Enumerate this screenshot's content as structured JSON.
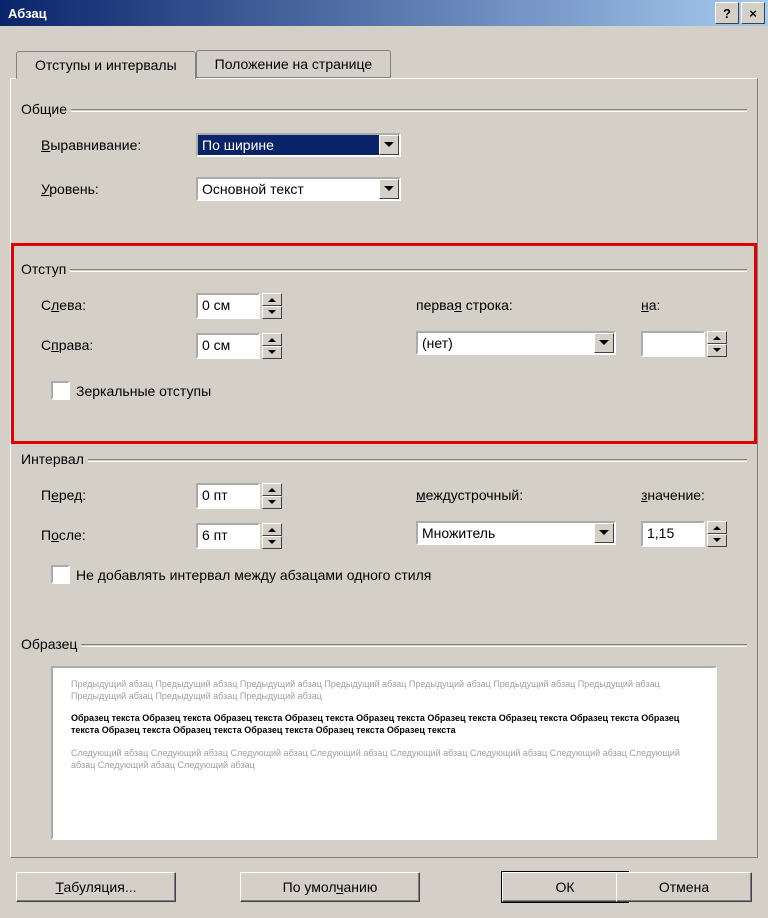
{
  "title": "Абзац",
  "tabs": {
    "active": "Отступы и интервалы",
    "other": "Положение на странице"
  },
  "groups": {
    "general": {
      "legend": "Общие",
      "alignment_label": "Выравнивание:",
      "alignment_value": "По ширине",
      "level_label": "Уровень:",
      "level_value": "Основной текст"
    },
    "indent": {
      "legend": "Отступ",
      "left_label": "Слева:",
      "left_value": "0 см",
      "right_label": "Справа:",
      "right_value": "0 см",
      "firstline_label": "первая строка:",
      "firstline_value": "(нет)",
      "by_label": "на:",
      "by_value": "",
      "mirror_label": "Зеркальные отступы"
    },
    "spacing": {
      "legend": "Интервал",
      "before_label": "Перед:",
      "before_value": "0 пт",
      "after_label": "После:",
      "after_value": "6 пт",
      "line_label": "междустрочный:",
      "line_value": "Множитель",
      "at_label": "значение:",
      "at_value": "1,15",
      "noadd_label": "Не добавлять интервал между абзацами одного стиля"
    },
    "preview": {
      "legend": "Образец",
      "prev_para": "Предыдущий абзац Предыдущий абзац Предыдущий абзац Предыдущий абзац Предыдущий абзац Предыдущий абзац Предыдущий абзац Предыдущий абзац Предыдущий абзац Предыдущий абзац",
      "sample": "Образец текста Образец текста Образец текста Образец текста Образец текста Образец текста Образец текста Образец текста Образец текста Образец текста Образец текста Образец текста Образец текста Образец текста",
      "next_para": "Следующий абзац Следующий абзац Следующий абзац Следующий абзац Следующий абзац Следующий абзац Следующий абзац Следующий абзац Следующий абзац Следующий абзац"
    }
  },
  "buttons": {
    "tabs": "Табуляция...",
    "default": "По умолчанию",
    "ok": "ОК",
    "cancel": "Отмена"
  }
}
